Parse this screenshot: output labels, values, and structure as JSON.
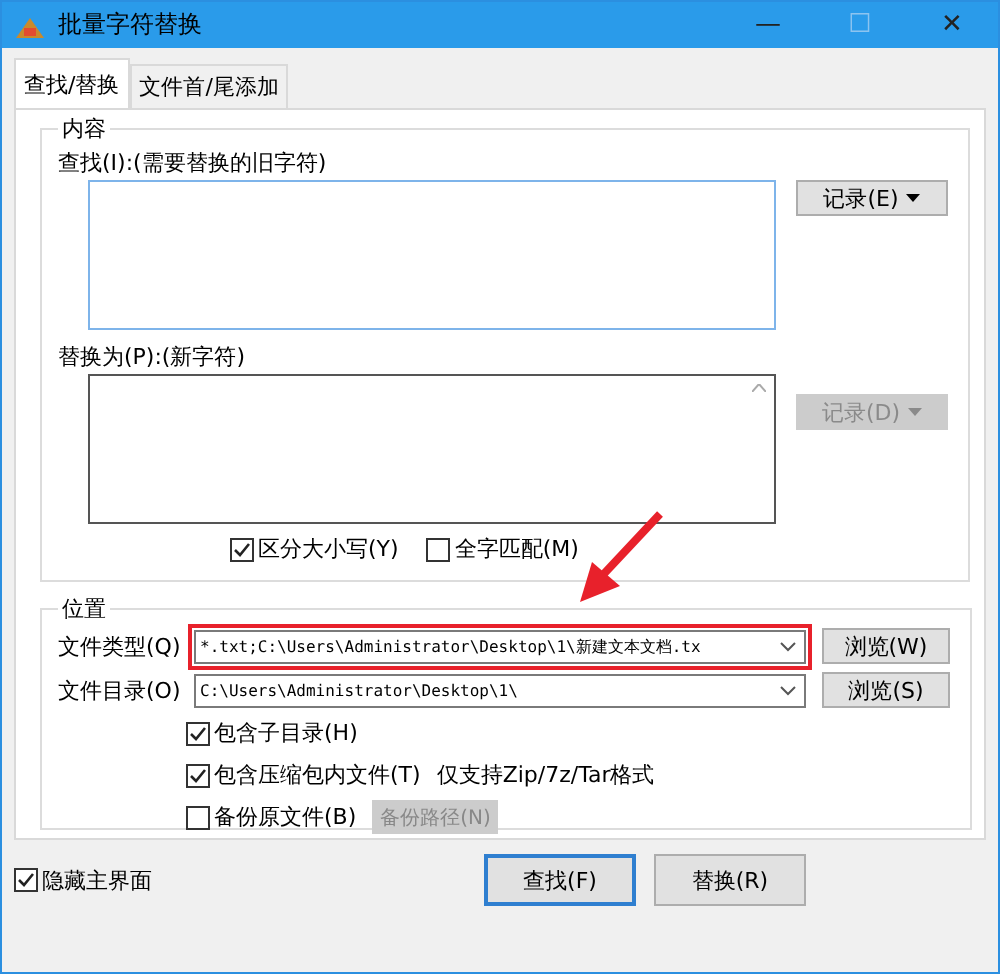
{
  "window": {
    "title": "批量字符替换",
    "controls": [
      "—",
      "☐",
      "✕"
    ]
  },
  "tabs": [
    {
      "label": "查找/替换",
      "selected": true
    },
    {
      "label": "文件首/尾添加",
      "selected": false
    }
  ],
  "content_group": {
    "title": "内容",
    "find": {
      "label": "查找(I):(需要替换的旧字符)",
      "history_button": {
        "label": "记录(E)",
        "disabled": false
      }
    },
    "replace": {
      "label": "替换为(P):(新字符)",
      "history_button": {
        "label": "记录(D)",
        "disabled": true
      }
    },
    "options": [
      {
        "label": "区分大小写(Y)",
        "checked": true
      },
      {
        "label": "全字匹配(M)",
        "checked": false
      }
    ]
  },
  "location_group": {
    "title": "位置",
    "rows": [
      {
        "label": "文件类型(Q)",
        "value": "*.txt;C:\\Users\\Administrator\\Desktop\\1\\新建文本文档.tx",
        "button": "浏览(W)",
        "highlighted": true
      },
      {
        "label": "文件目录(O)",
        "value": "C:\\Users\\Administrator\\Desktop\\1\\",
        "button": "浏览(S)",
        "highlighted": false
      }
    ],
    "options": [
      {
        "label": "包含子目录(H)",
        "checked": true
      },
      {
        "label": "包含压缩包内文件(T)",
        "checked": true,
        "note": "仅支持Zip/7z/Tar格式"
      },
      {
        "label": "备份原文件(B)",
        "checked": false,
        "button": {
          "label": "备份路径(N)",
          "disabled": true
        }
      }
    ]
  },
  "footer": {
    "hide_main": {
      "label": "隐藏主界面",
      "checked": true
    },
    "buttons": [
      {
        "label": "查找(F)",
        "default": true
      },
      {
        "label": "替换(R)",
        "default": false
      }
    ]
  }
}
